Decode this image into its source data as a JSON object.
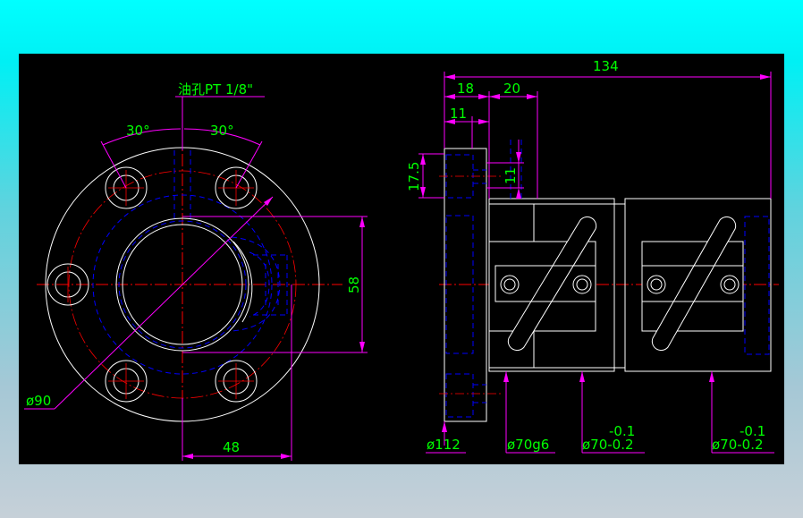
{
  "drawing": {
    "front_view": {
      "oil_hole_note": "油孔PT 1/8\"",
      "angle_left": "30°",
      "angle_right": "30°",
      "dim_58": "58",
      "dim_dia90": "ø90",
      "dim_48": "48"
    },
    "side_view": {
      "dim_134": "134",
      "dim_18": "18",
      "dim_20": "20",
      "dim_11_top": "11",
      "dim_17_5": "17.5",
      "dim_11_side": "11",
      "dim_dia112": "ø112",
      "dim_dia70g6": "ø70g6",
      "tol_1": "-0.1",
      "dim_dia70_1": "ø70-0.2",
      "tol_2": "-0.1",
      "dim_dia70_2": "ø70-0.2"
    }
  },
  "colors": {
    "background_top": "#00ffff",
    "canvas": "#000000",
    "outline": "#ffffff",
    "center_line": "#ff0000",
    "hidden_line": "#0000ff",
    "dimension_line": "#ff00ff",
    "dimension_text": "#00ff00"
  }
}
